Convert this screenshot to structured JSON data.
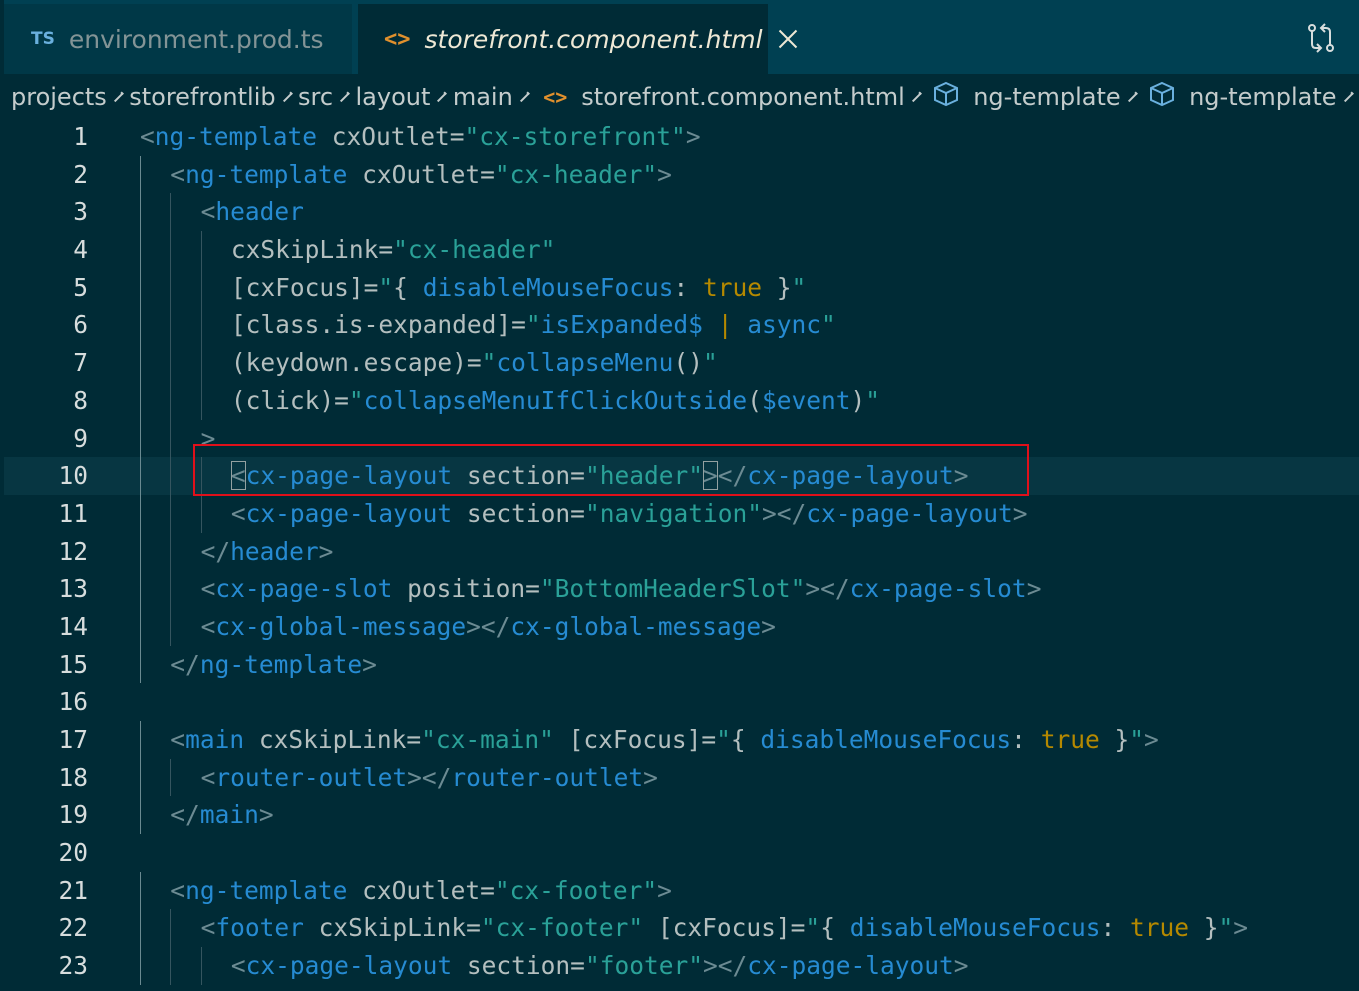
{
  "tabs": [
    {
      "icon": "TS",
      "label": "environment.prod.ts"
    },
    {
      "label": "storefront.component.html"
    }
  ],
  "breadcrumb": [
    "projects",
    "storefrontlib",
    "src",
    "layout",
    "main",
    "storefront.component.html",
    "ng-template",
    "ng-template"
  ],
  "lines": [
    {
      "n": 1,
      "ind": 0,
      "toks": [
        [
          "br",
          "<"
        ],
        [
          "tag",
          "ng-template"
        ],
        [
          "at",
          " cxOutlet="
        ],
        [
          "str",
          "\"cx-storefront\""
        ],
        [
          "br",
          ">"
        ]
      ]
    },
    {
      "n": 2,
      "ind": 1,
      "toks": [
        [
          "br",
          "<"
        ],
        [
          "tag",
          "ng-template"
        ],
        [
          "at",
          " cxOutlet="
        ],
        [
          "str",
          "\"cx-header\""
        ],
        [
          "br",
          ">"
        ]
      ]
    },
    {
      "n": 3,
      "ind": 2,
      "toks": [
        [
          "br",
          "<"
        ],
        [
          "tag",
          "header"
        ]
      ]
    },
    {
      "n": 4,
      "ind": 3,
      "toks": [
        [
          "at",
          "cxSkipLink="
        ],
        [
          "str",
          "\"cx-header\""
        ]
      ]
    },
    {
      "n": 5,
      "ind": 3,
      "toks": [
        [
          "at",
          "[cxFocus]="
        ],
        [
          "str",
          "\""
        ],
        [
          "at",
          "{ "
        ],
        [
          "fn",
          "disableMouseFocus"
        ],
        [
          "at",
          ": "
        ],
        [
          "kw",
          "true"
        ],
        [
          "at",
          " }"
        ],
        [
          "str",
          "\""
        ]
      ]
    },
    {
      "n": 6,
      "ind": 3,
      "toks": [
        [
          "at",
          "[class.is-expanded]="
        ],
        [
          "str",
          "\""
        ],
        [
          "fn",
          "isExpanded$"
        ],
        [
          "at",
          " "
        ],
        [
          "kw",
          "|"
        ],
        [
          "at",
          " "
        ],
        [
          "fn",
          "async"
        ],
        [
          "str",
          "\""
        ]
      ]
    },
    {
      "n": 7,
      "ind": 3,
      "toks": [
        [
          "at",
          "(keydown.escape)="
        ],
        [
          "str",
          "\""
        ],
        [
          "fn",
          "collapseMenu"
        ],
        [
          "at",
          "()"
        ],
        [
          "str",
          "\""
        ]
      ]
    },
    {
      "n": 8,
      "ind": 3,
      "toks": [
        [
          "at",
          "(click)="
        ],
        [
          "str",
          "\""
        ],
        [
          "fn",
          "collapseMenuIfClickOutside"
        ],
        [
          "at",
          "("
        ],
        [
          "fn",
          "$event"
        ],
        [
          "at",
          ")"
        ],
        [
          "str",
          "\""
        ]
      ]
    },
    {
      "n": 9,
      "ind": 2,
      "toks": [
        [
          "br",
          ">"
        ]
      ]
    },
    {
      "n": 10,
      "ind": 3,
      "active": true,
      "toks": [
        [
          "br",
          "<",
          "box"
        ],
        [
          "tag",
          "cx-page-layout"
        ],
        [
          "at",
          " section="
        ],
        [
          "str",
          "\"header\""
        ],
        [
          "br",
          ">",
          "box"
        ],
        [
          "br",
          "</"
        ],
        [
          "tag",
          "cx-page-layout"
        ],
        [
          "br",
          ">"
        ]
      ]
    },
    {
      "n": 11,
      "ind": 3,
      "toks": [
        [
          "br",
          "<"
        ],
        [
          "tag",
          "cx-page-layout"
        ],
        [
          "at",
          " section="
        ],
        [
          "str",
          "\"navigation\""
        ],
        [
          "br",
          "></"
        ],
        [
          "tag",
          "cx-page-layout"
        ],
        [
          "br",
          ">"
        ]
      ]
    },
    {
      "n": 12,
      "ind": 2,
      "toks": [
        [
          "br",
          "</"
        ],
        [
          "tag",
          "header"
        ],
        [
          "br",
          ">"
        ]
      ]
    },
    {
      "n": 13,
      "ind": 2,
      "toks": [
        [
          "br",
          "<"
        ],
        [
          "tag",
          "cx-page-slot"
        ],
        [
          "at",
          " position="
        ],
        [
          "str",
          "\"BottomHeaderSlot\""
        ],
        [
          "br",
          "></"
        ],
        [
          "tag",
          "cx-page-slot"
        ],
        [
          "br",
          ">"
        ]
      ]
    },
    {
      "n": 14,
      "ind": 2,
      "toks": [
        [
          "br",
          "<"
        ],
        [
          "tag",
          "cx-global-message"
        ],
        [
          "br",
          "></"
        ],
        [
          "tag",
          "cx-global-message"
        ],
        [
          "br",
          ">"
        ]
      ]
    },
    {
      "n": 15,
      "ind": 1,
      "toks": [
        [
          "br",
          "</"
        ],
        [
          "tag",
          "ng-template"
        ],
        [
          "br",
          ">"
        ]
      ]
    },
    {
      "n": 16,
      "ind": 0,
      "toks": []
    },
    {
      "n": 17,
      "ind": 1,
      "toks": [
        [
          "br",
          "<"
        ],
        [
          "tag",
          "main"
        ],
        [
          "at",
          " cxSkipLink="
        ],
        [
          "str",
          "\"cx-main\""
        ],
        [
          "at",
          " [cxFocus]="
        ],
        [
          "str",
          "\""
        ],
        [
          "at",
          "{ "
        ],
        [
          "fn",
          "disableMouseFocus"
        ],
        [
          "at",
          ": "
        ],
        [
          "kw",
          "true"
        ],
        [
          "at",
          " }"
        ],
        [
          "str",
          "\""
        ],
        [
          "br",
          ">"
        ]
      ]
    },
    {
      "n": 18,
      "ind": 2,
      "toks": [
        [
          "br",
          "<"
        ],
        [
          "tag",
          "router-outlet"
        ],
        [
          "br",
          "></"
        ],
        [
          "tag",
          "router-outlet"
        ],
        [
          "br",
          ">"
        ]
      ]
    },
    {
      "n": 19,
      "ind": 1,
      "toks": [
        [
          "br",
          "</"
        ],
        [
          "tag",
          "main"
        ],
        [
          "br",
          ">"
        ]
      ]
    },
    {
      "n": 20,
      "ind": 0,
      "toks": []
    },
    {
      "n": 21,
      "ind": 1,
      "toks": [
        [
          "br",
          "<"
        ],
        [
          "tag",
          "ng-template"
        ],
        [
          "at",
          " cxOutlet="
        ],
        [
          "str",
          "\"cx-footer\""
        ],
        [
          "br",
          ">"
        ]
      ]
    },
    {
      "n": 22,
      "ind": 2,
      "toks": [
        [
          "br",
          "<"
        ],
        [
          "tag",
          "footer"
        ],
        [
          "at",
          " cxSkipLink="
        ],
        [
          "str",
          "\"cx-footer\""
        ],
        [
          "at",
          " [cxFocus]="
        ],
        [
          "str",
          "\""
        ],
        [
          "at",
          "{ "
        ],
        [
          "fn",
          "disableMouseFocus"
        ],
        [
          "at",
          ": "
        ],
        [
          "kw",
          "true"
        ],
        [
          "at",
          " }"
        ],
        [
          "str",
          "\""
        ],
        [
          "br",
          ">"
        ]
      ]
    },
    {
      "n": 23,
      "ind": 3,
      "toks": [
        [
          "br",
          "<"
        ],
        [
          "tag",
          "cx-page-layout"
        ],
        [
          "at",
          " section="
        ],
        [
          "str",
          "\"footer\""
        ],
        [
          "br",
          "></"
        ],
        [
          "tag",
          "cx-page-layout"
        ],
        [
          "br",
          ">"
        ]
      ]
    }
  ]
}
